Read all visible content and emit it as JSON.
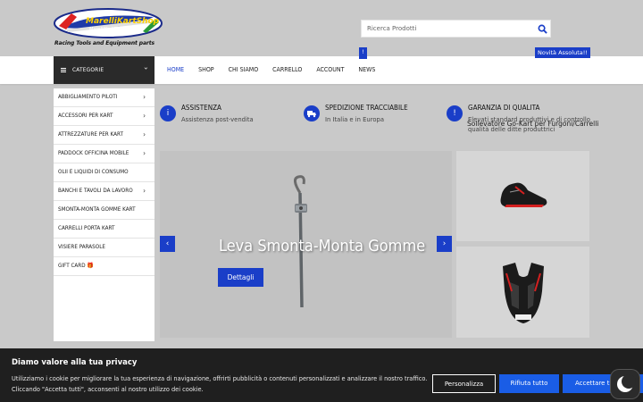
{
  "header": {
    "logo_text": "MarelliKartShop.com",
    "tagline": "Racing Tools and Equipment parts",
    "search_placeholder": "Ricerca Prodotti"
  },
  "nav": {
    "categories_label": "CATEGORIE",
    "items": [
      {
        "label": "HOME",
        "active": true
      },
      {
        "label": "SHOP"
      },
      {
        "label": "CHI SIAMO"
      },
      {
        "label": "CARRELLO"
      },
      {
        "label": "ACCOUNT"
      },
      {
        "label": "NEWS"
      }
    ],
    "news_badge": "!",
    "novita_badge": "Novità Assoluta!!",
    "ticker": "Sollevatore Go-Kart per Furgoni/Carrelli"
  },
  "sidebar": {
    "items": [
      {
        "label": "ABBIGLIAMENTO PILOTI",
        "arrow": "›"
      },
      {
        "label": "ACCESSORI PER KART",
        "arrow": "›"
      },
      {
        "label": "ATTREZZATURE PER KART",
        "arrow": "›"
      },
      {
        "label": "PADDOCK OFFICINA MOBILE",
        "arrow": "›"
      },
      {
        "label": "OLII E LIQUIDI DI CONSUMO",
        "arrow": ""
      },
      {
        "label": "BANCHI E TAVOLI DA LAVORO",
        "arrow": "›"
      },
      {
        "label": "SMONTA-MONTA GOMME KART",
        "arrow": ""
      },
      {
        "label": "CARRELLI PORTA KART",
        "arrow": ""
      },
      {
        "label": "VISIERE PARASOLE",
        "arrow": ""
      },
      {
        "label": "GIFT CARD 🎁",
        "arrow": ""
      }
    ]
  },
  "features": [
    {
      "title": "ASSISTENZA",
      "desc": "Assistenza post-vendita",
      "icon": "info-icon"
    },
    {
      "title": "SPEDIZIONE TRACCIABILE",
      "desc": "In Italia e in Europa",
      "icon": "truck-icon"
    },
    {
      "title": "GARANZIA DI QUALITA",
      "desc": "Elevati standard produttivi e di controllo qualità delle ditte produttrici",
      "icon": "warning-icon"
    }
  ],
  "slider": {
    "title": "Leva Smonta-Monta Gomme",
    "button": "Dettagli",
    "prev": "‹",
    "next": "›"
  },
  "cookie": {
    "title": "Diamo valore alla tua privacy",
    "text": "Utilizziamo i cookie per migliorare la tua esperienza di navigazione, offrirti pubblicità o contenuti personalizzati e analizzare il nostro traffico. Cliccando \"Accetta tutti\", acconsenti al nostro utilizzo dei cookie.",
    "btn_customize": "Personalizza",
    "btn_reject": "Rifiuta tutto",
    "btn_accept": "Accettare tutti"
  },
  "colors": {
    "accent": "#1a3ec8",
    "background": "#c9c9c9",
    "cookie_bg": "#1f1f1f"
  }
}
